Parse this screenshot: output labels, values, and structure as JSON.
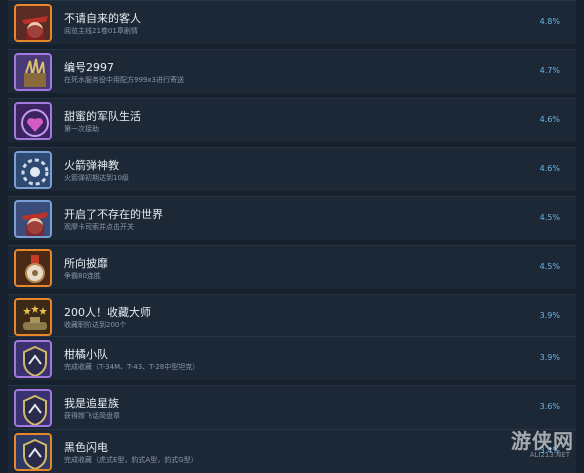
{
  "achievements": [
    {
      "title": "不请自来的客人",
      "desc": "阅览主线21卷01章剧情",
      "pct": "4.8%",
      "icon": "red-hat-girl-icon"
    },
    {
      "title": "编号2997",
      "desc": "在死水服务役中用配方999x3进行寄送",
      "pct": "4.7%",
      "icon": "gift-box-icon"
    },
    {
      "title": "甜蜜的军队生活",
      "desc": "第一次接助",
      "pct": "4.6%",
      "icon": "heart-badge-icon"
    },
    {
      "title": "火箭弹神教",
      "desc": "火箭弹初期达到10级",
      "pct": "4.6%",
      "icon": "rocket-gear-icon"
    },
    {
      "title": "开启了不存在的世界",
      "desc": "观摩卡司索并点击开关",
      "pct": "4.5%",
      "icon": "red-hat-girl-icon"
    },
    {
      "title": "所向披靡",
      "desc": "争霸80连胜",
      "pct": "4.5%",
      "icon": "medal-icon"
    },
    {
      "title": "200人！收藏大师",
      "desc": "收藏职阶达到200个",
      "pct": "3.9%",
      "icon": "tank-stars-icon"
    },
    {
      "title": "柑橘小队",
      "desc": "完成收藏（T-34M、T-43、T-28中型坦克）",
      "pct": "3.9%",
      "icon": "shield-badge-icon"
    },
    {
      "title": "我是追星族",
      "desc": "获得嫦飞话简盘章",
      "pct": "3.6%",
      "icon": "shield-badge-icon"
    },
    {
      "title": "黑色闪电",
      "desc": "完成收藏（虎式E型，豹式A型，豹式G型）",
      "pct": "3.4%",
      "icon": "shield-badge-icon"
    }
  ],
  "watermark": {
    "text": "游侠网",
    "url": "ALI213.NET"
  }
}
